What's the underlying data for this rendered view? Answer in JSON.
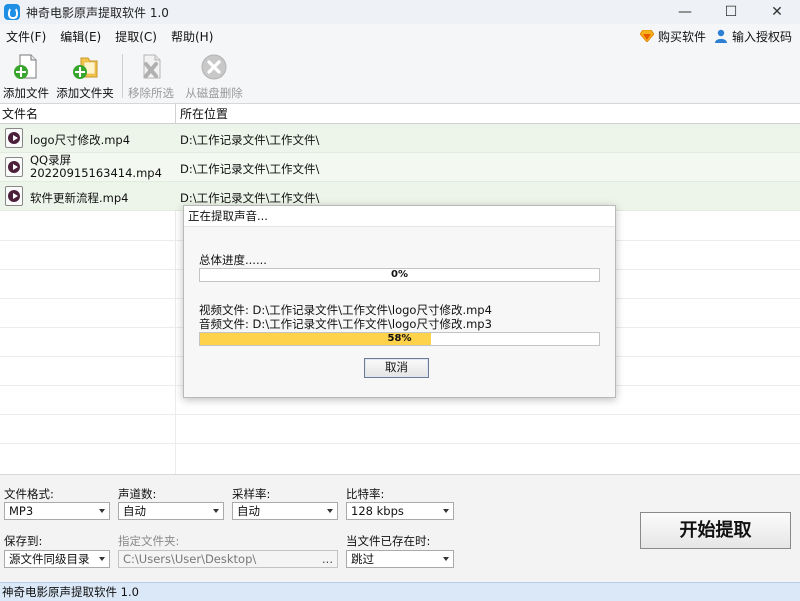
{
  "window": {
    "title": "神奇电影原声提取软件 1.0",
    "controls": {
      "minimize": "—",
      "maximize": "☐",
      "close": "✕"
    }
  },
  "menu": {
    "items": [
      "文件(F)",
      "编辑(E)",
      "提取(C)",
      "帮助(H)"
    ],
    "right": {
      "buy": "购买软件",
      "license": "输入授权码"
    }
  },
  "toolbar": {
    "add_file": "添加文件",
    "add_folder": "添加文件夹",
    "remove_selected": "移除所选",
    "delete_from_disk": "从磁盘删除"
  },
  "file_list": {
    "columns": [
      "文件名",
      "所在位置"
    ],
    "rows": [
      {
        "name": "logo尺寸修改.mp4",
        "name_line2": "",
        "path": "D:\\工作记录文件\\工作文件\\"
      },
      {
        "name": "QQ录屏",
        "name_line2": "20220915163414.mp4",
        "path": "D:\\工作记录文件\\工作文件\\"
      },
      {
        "name": "软件更新流程.mp4",
        "name_line2": "",
        "path": "D:\\工作记录文件\\工作文件\\"
      }
    ]
  },
  "progress_dialog": {
    "title": "正在提取声音...",
    "overall_label": "总体进度......",
    "overall_percent": 0,
    "overall_text": "0%",
    "video_file": "视频文件: D:\\工作记录文件\\工作文件\\logo尺寸修改.mp4",
    "audio_file": "音频文件: D:\\工作记录文件\\工作文件\\logo尺寸修改.mp3",
    "file_percent": 58,
    "file_text": "58%",
    "cancel": "取消"
  },
  "settings": {
    "format_label": "文件格式:",
    "format_value": "MP3",
    "channels_label": "声道数:",
    "channels_value": "自动",
    "samplerate_label": "采样率:",
    "samplerate_value": "自动",
    "bitrate_label": "比特率:",
    "bitrate_value": "128 kbps",
    "saveto_label": "保存到:",
    "saveto_value": "源文件同级目录",
    "folder_label": "指定文件夹:",
    "folder_value": "C:\\Users\\User\\Desktop\\",
    "folder_browse": "...",
    "exists_label": "当文件已存在时:",
    "exists_value": "跳过",
    "start": "开始提取"
  },
  "statusbar": {
    "text": "神奇电影原声提取软件 1.0"
  },
  "colors": {
    "progress_fill": "#ffd24c",
    "row_highlight": "#edf5ea",
    "statusbar": "#dbe8f7"
  }
}
